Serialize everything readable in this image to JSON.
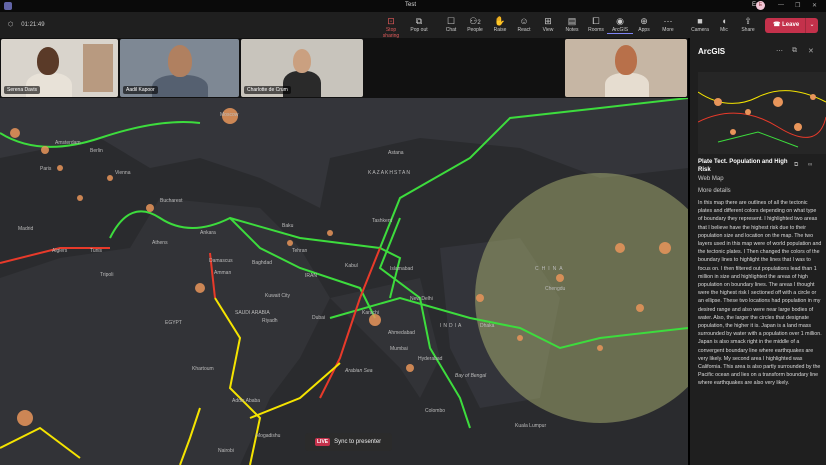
{
  "window": {
    "title": "Test",
    "user": "Esri",
    "avatar_initial": "E",
    "minimize": "—",
    "restore": "❐",
    "close": "✕"
  },
  "toolbar": {
    "timer": "01:21:49",
    "buttons": [
      {
        "label": "Stop sharing",
        "icon": "⊡"
      },
      {
        "label": "Pop out",
        "icon": "⧉"
      },
      {
        "label": "Chat",
        "icon": "☐"
      },
      {
        "label": "People",
        "icon": "⚇"
      },
      {
        "label": "Raise",
        "icon": "✋"
      },
      {
        "label": "React",
        "icon": "☺"
      },
      {
        "label": "View",
        "icon": "⊞"
      },
      {
        "label": "Notes",
        "icon": "▤"
      },
      {
        "label": "Rooms",
        "icon": "⧠"
      },
      {
        "label": "ArcGIS",
        "icon": "◉"
      },
      {
        "label": "Apps",
        "icon": "⊕"
      },
      {
        "label": "More",
        "icon": "⋯"
      },
      {
        "label": "Camera",
        "icon": "■"
      },
      {
        "label": "Mic",
        "icon": "◖"
      },
      {
        "label": "Share",
        "icon": "⇪"
      }
    ],
    "people_count": "2",
    "leave": "Leave"
  },
  "participants": [
    {
      "name": "Serena Davis"
    },
    {
      "name": "Aadil Kapoor"
    },
    {
      "name": "Charlotte de Crum"
    },
    {
      "name": ""
    }
  ],
  "map": {
    "labels": [
      "Moscow",
      "Amsterdam",
      "Berlin",
      "Paris",
      "Vienna",
      "Bucharest",
      "Madrid",
      "Algiers",
      "Tunis",
      "Tripoli",
      "Athens",
      "Ankara",
      "Damascus",
      "Amman",
      "Baghdad",
      "Tehran",
      "Kuwait City",
      "Riyadh",
      "Dubai",
      "Karachi",
      "Islamabad",
      "New Delhi",
      "Mumbai",
      "Hyderabad",
      "Dhaka",
      "Colombo",
      "Kabul",
      "Tashkent",
      "Astana",
      "Baku",
      "Khartoum",
      "Addis Ababa",
      "Mogadishu",
      "Nairobi",
      "Kuala Lumpur",
      "CHINA",
      "KAZAKHSTAN",
      "IRAN",
      "SAUDI ARABIA",
      "EGYPT",
      "INDIA",
      "Arabian Sea",
      "Bay of Bengal",
      "Chengdu",
      "Ahmedabad"
    ],
    "sync_live": "LIVE",
    "sync_label": "Sync to presenter",
    "colors": {
      "green": "#3ddc3d",
      "red": "#e83a2a",
      "yellow": "#f5e400",
      "pop": "#e8955a",
      "circle": "#b7c27a"
    }
  },
  "panel": {
    "title": "ArcGIS",
    "item_title": "Plate Tect. Population and High Risk",
    "item_type": "Web Map",
    "more_details": "More details",
    "description": "In this map there are outlines of all the tectonic plates and different colors depending on what type of boundary they represent. I highlighted two areas that I believe have the highest risk due to their population size and location on the map. The two layers used in this map were of world population and the tectonic plates. I Then changed the colors of the boundary lines to highlight the lines that I was to focus on. I then filtered out populations lead than 1 million in size and highlighted the areas of high population on boundary lines. The areas I thought were the highest risk I sectioned off with a circle or an ellipse. These two locations had population in my desired range and also were near large bodies of water. Also, the larger the circles that designate population, the higher it is. Japan is a land mass surrounded by water with a population over 1 million. Japan is also smack right in the middle of a convergent boundary line where earthquakes are very likely. My second area I highlighted was California. This area is also partly surrounded by the Pacific ocean and lies on a transform boundary line where earthquakes are also very likely."
  }
}
